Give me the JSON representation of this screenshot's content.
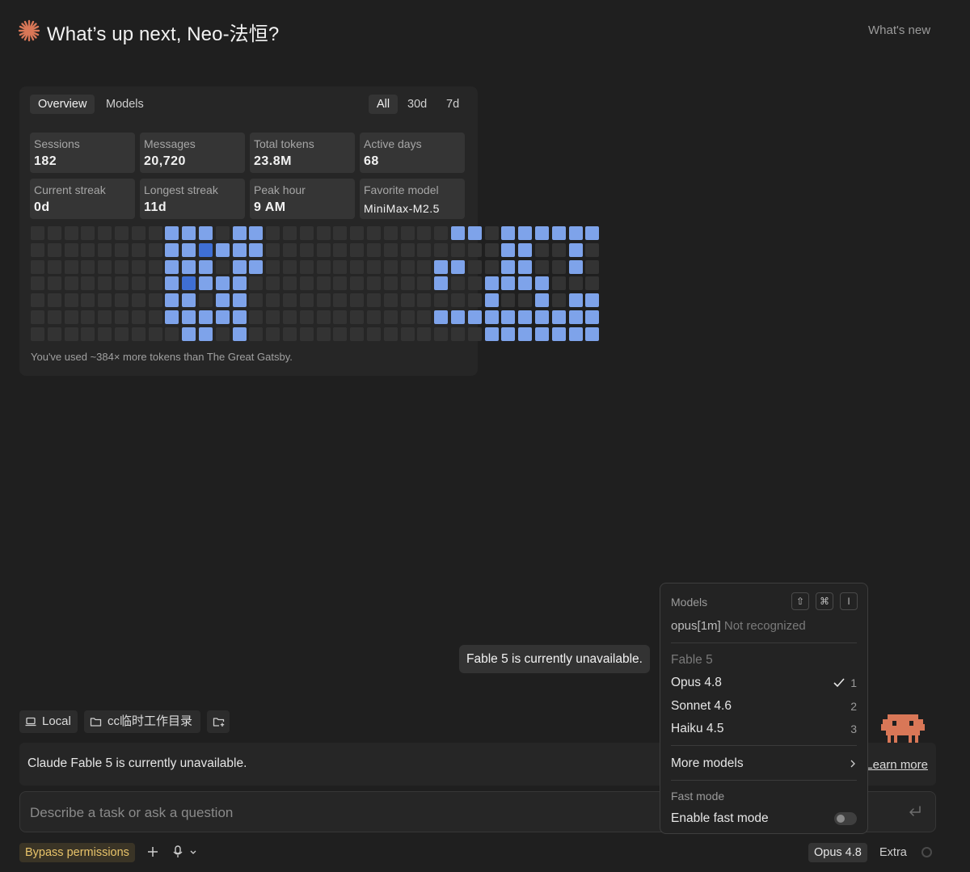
{
  "header": {
    "title": "What’s up next, Neo-法恒?",
    "whats_new": "What's new"
  },
  "stats": {
    "tabs": [
      "Overview",
      "Models"
    ],
    "ranges": [
      "All",
      "30d",
      "7d"
    ],
    "cards": [
      {
        "label": "Sessions",
        "value": "182"
      },
      {
        "label": "Messages",
        "value": "20,720"
      },
      {
        "label": "Total tokens",
        "value": "23.8M"
      },
      {
        "label": "Active days",
        "value": "68"
      },
      {
        "label": "Current streak",
        "value": "0d"
      },
      {
        "label": "Longest streak",
        "value": "11d"
      },
      {
        "label": "Peak hour",
        "value": "9 AM"
      },
      {
        "label": "Favorite model",
        "value": "MiniMax-M2.5"
      }
    ],
    "footer": "You've used ~384× more tokens than The Great Gatsby.",
    "heatmap": [
      "0000000011101100000000000110111111",
      "0000000011311100000000000000110010",
      "0000000011101100000000001100110010",
      "0000000013111000000000001001111000",
      "0000000011011000000000000001001011",
      "0000000011111000000000001111111111",
      "0000000001101000000000000001111111"
    ],
    "colors": {
      "empty": "#333333",
      "low": "#7ea3ea",
      "mid": "#6a93e6",
      "high": "#3f6fd4"
    }
  },
  "workspace": {
    "local": "Local",
    "directory": "cc临时工作目录"
  },
  "notice": {
    "text": "Claude Fable 5 is currently unavailable.",
    "learn_more": "Learn more"
  },
  "input": {
    "placeholder": "Describe a task or ask a question"
  },
  "footer": {
    "bypass": "Bypass permissions",
    "model": "Opus 4.8",
    "extra": "Extra"
  },
  "tooltip": "Fable 5 is currently unavailable.",
  "models_menu": {
    "header": "Models",
    "shortcut": [
      "⇧",
      "⌘",
      "I"
    ],
    "current": "opus[1m]",
    "current_status": "Not recognized",
    "items": [
      {
        "label": "Fable 5",
        "number": "",
        "disabled": true
      },
      {
        "label": "Opus 4.8",
        "number": "1",
        "checked": true
      },
      {
        "label": "Sonnet 4.6",
        "number": "2"
      },
      {
        "label": "Haiku 4.5",
        "number": "3"
      }
    ],
    "more_models": "More models",
    "fast_mode_header": "Fast mode",
    "fast_mode_label": "Enable fast mode",
    "fast_mode_enabled": false
  }
}
